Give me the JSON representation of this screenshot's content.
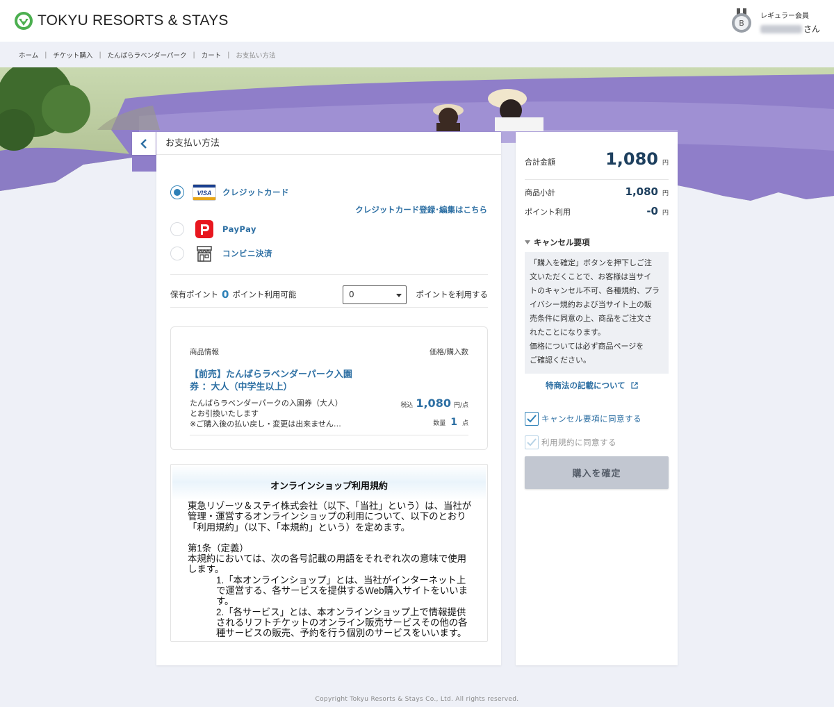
{
  "header": {
    "brand": "TOKYU RESORTS & STAYS",
    "member_badge_letter": "B",
    "member_rank": "レギュラー会員",
    "member_name_suffix": "さん"
  },
  "breadcrumb": [
    "ホーム",
    "チケット購入",
    "たんばらラベンダーパーク",
    "カート",
    "お支払い方法"
  ],
  "payment": {
    "heading": "お支払い方法",
    "options": [
      {
        "label": "クレジットカード",
        "selected": true,
        "icon": "visa-card-icon"
      },
      {
        "label": "PayPay",
        "selected": false,
        "icon": "paypay-icon"
      },
      {
        "label": "コンビニ決済",
        "selected": false,
        "icon": "convenience-store-icon"
      }
    ],
    "cc_link": "クレジットカード登録･編集はこちら"
  },
  "points": {
    "held_label": "保有ポイント",
    "held_value": "0",
    "usable_label": "ポイント利用可能",
    "select_value": "0",
    "apply_label": "ポイントを利用する"
  },
  "product": {
    "col_info": "商品情報",
    "col_price": "価格/購入数",
    "title_line1": "【前売】たんばらラベンダーパーク入園",
    "title_line2": "券 ：大人（中学生以上）",
    "desc_line1": "たんばらラベンダーパークの入園券（大人）",
    "desc_line2": "とお引換いたします",
    "desc_line3": "※ご購入後の払い戻し・変更は出来ません…",
    "tax_label": "税込",
    "price": "1,080",
    "price_unit": "円/点",
    "qty_label": "数量",
    "qty": "1",
    "qty_unit": "点"
  },
  "terms": {
    "title": "オンラインショップ利用規約",
    "intro": "東急リゾーツ＆ステイ株式会社（以下、「当社」という）は、当社が管理・運営するオンラインショップの利用について、以下のとおり「利用規約」（以下、「本規約」という）を定めます。",
    "article1_title": "第1条（定義）",
    "article1_body": "本規約においては、次の各号記載の用語をそれぞれ次の意味で使用します。",
    "item1": "1.「本オンラインショップ」とは、当社がインターネット上で運営する、各サービスを提供するWeb購入サイトをいいます。",
    "item2": "2.「各サービス」とは、本オンラインショップ上で情報提供されるリフトチケットのオンライン販売サービスその他の各種サービスの販売、予約を行う個別のサービスをいいます。"
  },
  "summary": {
    "total_label": "合計金額",
    "total_value": "1,080",
    "yen": "円",
    "subtotal_label": "商品小計",
    "subtotal_value": "1,080",
    "points_label": "ポイント利用",
    "points_value": "-0",
    "cancel_heading": "キャンセル要項",
    "cancel_lines": [
      "「購入を確定」ボタンを押下しご注",
      "文いただくことで、お客様は当サイ",
      "トのキャンセル不可、各種規約、プラ",
      "イバシー規約および当サイト上の販",
      "売条件に同意の上、商品をご注文さ",
      "れたことになります。",
      "価格については必ず商品ページを",
      "ご確認ください。"
    ],
    "tokushoho_link": "特商法の記載について",
    "agree_cancel": "キャンセル要項に同意する",
    "agree_terms": "利用規約に同意する",
    "confirm_button": "購入を確定"
  },
  "footer": {
    "copyright": "Copyright Tokyu Resorts & Stays Co., Ltd. All rights reserved."
  },
  "colors": {
    "accent": "#2d80b7",
    "link": "#2d6fa3",
    "price": "#1d3f5e",
    "disabled_button": "#c2c7d1",
    "background": "#eef0f7"
  }
}
